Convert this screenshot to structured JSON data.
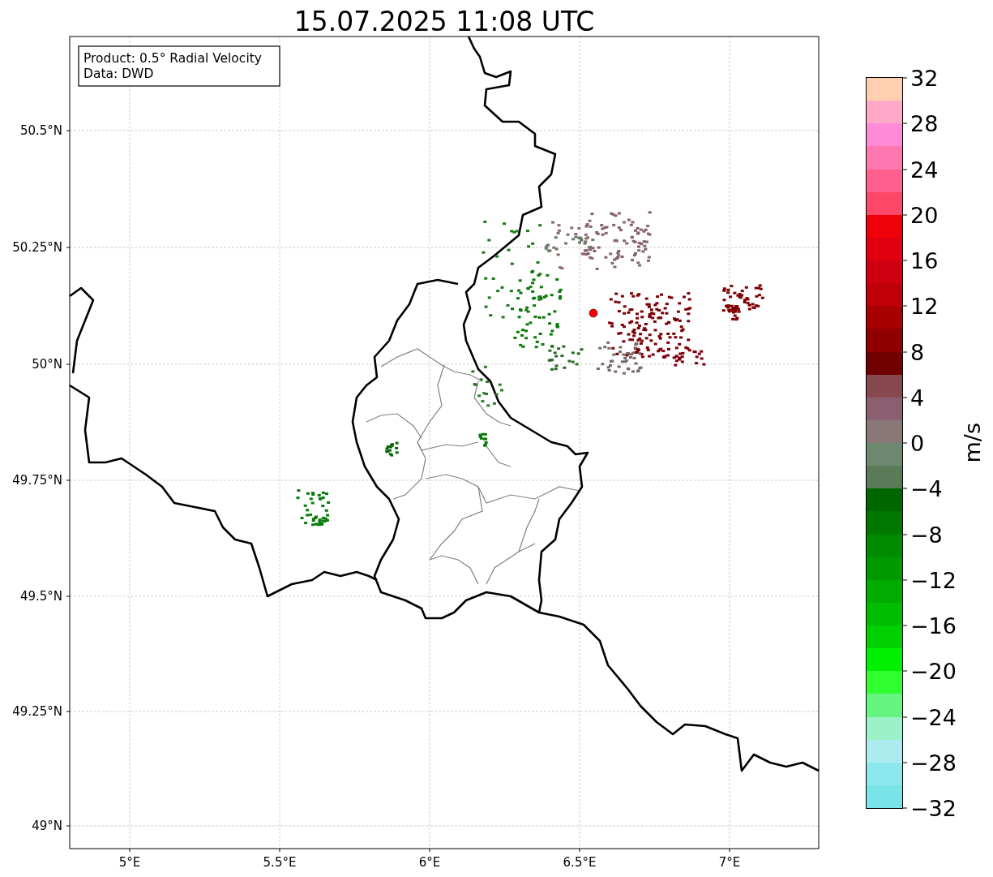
{
  "title": "15.07.2025 11:08 UTC",
  "info_box": {
    "lines": [
      "Product: 0.5° Radial Velocity",
      "Data: DWD"
    ]
  },
  "map": {
    "x_ticks": [
      "5°E",
      "5.5°E",
      "6°E",
      "6.5°E",
      "7°E"
    ],
    "y_ticks": [
      "50.5°N",
      "50.25°N",
      "50°N",
      "49.75°N",
      "49.5°N",
      "49.25°N",
      "49°N"
    ]
  },
  "colorbar": {
    "label": "m/s",
    "ticks": [
      "32",
      "28",
      "24",
      "20",
      "16",
      "12",
      "8",
      "4",
      "0",
      "−4",
      "−8",
      "−12",
      "−16",
      "−20",
      "−24",
      "−28",
      "−32"
    ],
    "bins": [
      {
        "color": "#ffcfb0"
      },
      {
        "color": "#ffa8c8"
      },
      {
        "color": "#ff8ad6"
      },
      {
        "color": "#ff78b0"
      },
      {
        "color": "#ff6090"
      },
      {
        "color": "#ff4868"
      },
      {
        "color": "#f00008"
      },
      {
        "color": "#e00010"
      },
      {
        "color": "#d00010"
      },
      {
        "color": "#c00008"
      },
      {
        "color": "#a80000"
      },
      {
        "color": "#900000"
      },
      {
        "color": "#700000"
      },
      {
        "color": "#884850"
      },
      {
        "color": "#8a6070"
      },
      {
        "color": "#8a7878"
      },
      {
        "color": "#6f8870"
      },
      {
        "color": "#5a7a58"
      },
      {
        "color": "#006600"
      },
      {
        "color": "#007800"
      },
      {
        "color": "#008a00"
      },
      {
        "color": "#009a00"
      },
      {
        "color": "#00ac00"
      },
      {
        "color": "#00bc00"
      },
      {
        "color": "#00d000"
      },
      {
        "color": "#00f000"
      },
      {
        "color": "#30ff30"
      },
      {
        "color": "#66f480"
      },
      {
        "color": "#9cf2c8"
      },
      {
        "color": "#acecee"
      },
      {
        "color": "#8ce8ec"
      },
      {
        "color": "#78e4e8"
      }
    ]
  }
}
